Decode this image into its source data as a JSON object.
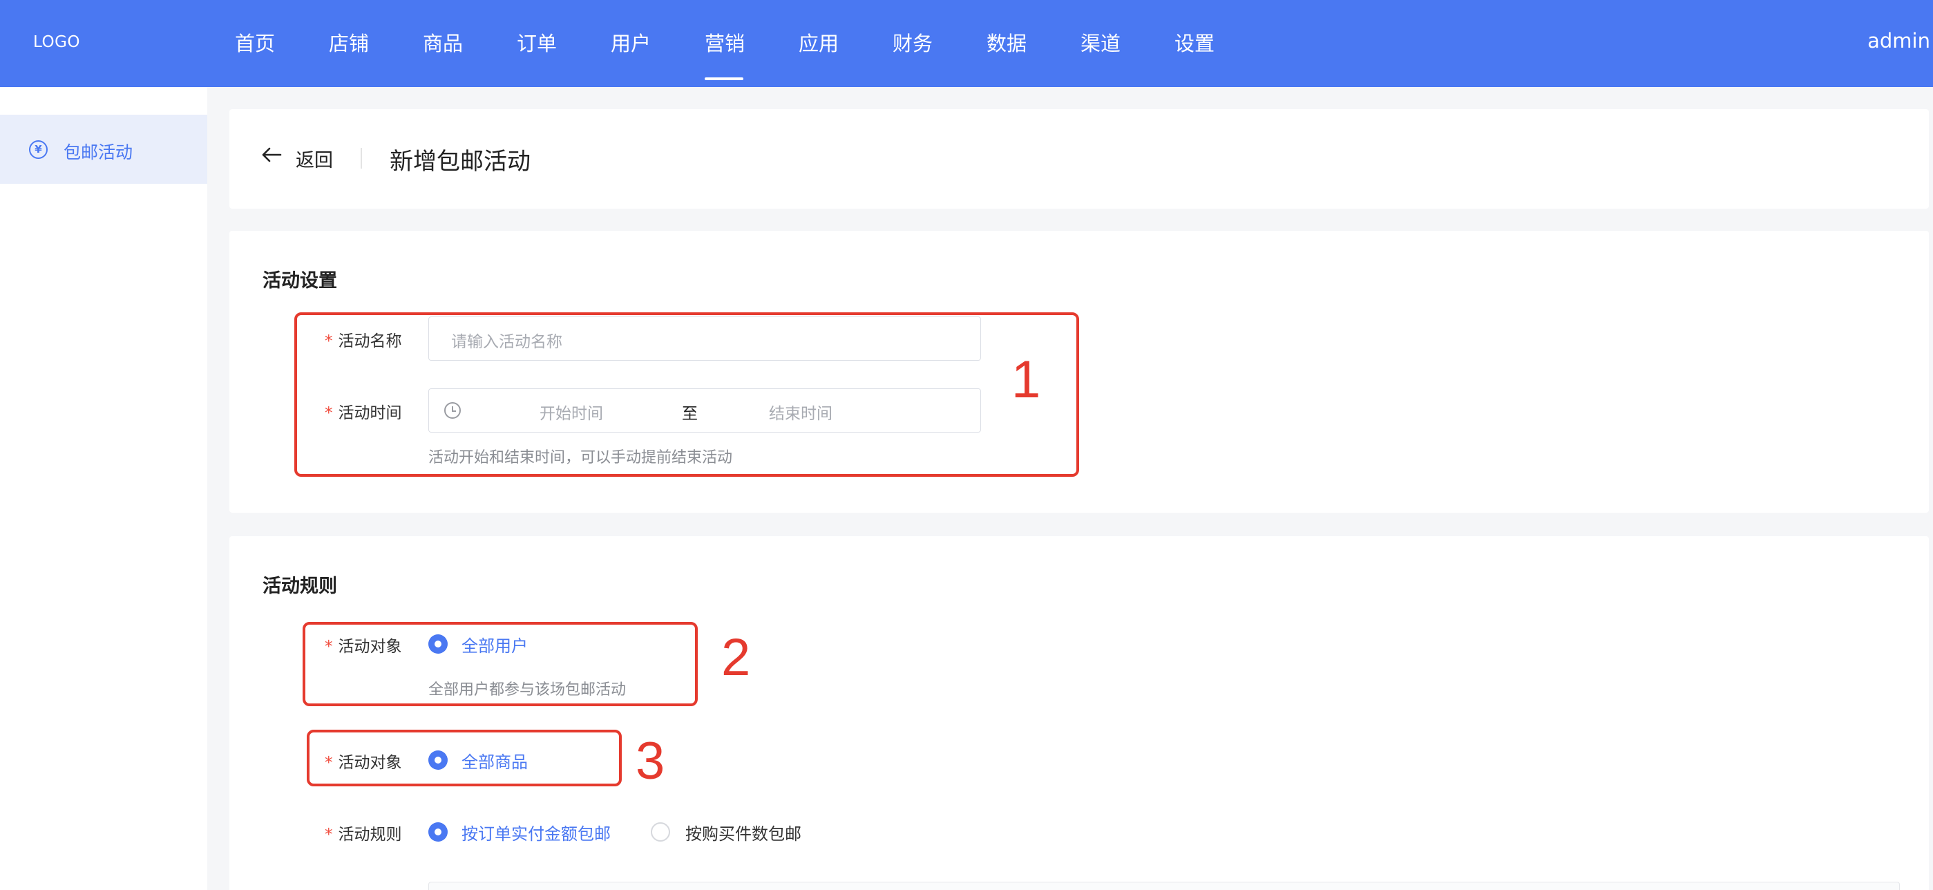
{
  "header": {
    "logo": "LOGO",
    "nav": [
      "首页",
      "店铺",
      "商品",
      "订单",
      "用户",
      "营销",
      "应用",
      "财务",
      "数据",
      "渠道",
      "设置"
    ],
    "active_nav": "营销",
    "user": "admin",
    "colors": {
      "brand": "#4a78f2",
      "annotation": "#e53a2e",
      "required": "#f04a3b"
    }
  },
  "sidebar": {
    "items": [
      {
        "label": "包邮活动",
        "icon": "yen-circle-icon",
        "active": true
      }
    ]
  },
  "page_header": {
    "back_label": "返回",
    "title": "新增包邮活动"
  },
  "settings": {
    "title": "活动设置",
    "name_label": "活动名称",
    "name_placeholder": "请输入活动名称",
    "time_label": "活动时间",
    "start_placeholder": "开始时间",
    "range_sep": "至",
    "end_placeholder": "结束时间",
    "time_help": "活动开始和结束时间，可以手动提前结束活动"
  },
  "rules": {
    "title": "活动规则",
    "target_user_label": "活动对象",
    "target_user_option": "全部用户",
    "target_user_help": "全部用户都参与该场包邮活动",
    "target_goods_label": "活动对象",
    "target_goods_option": "全部商品",
    "rule_label": "活动规则",
    "rule_options": [
      "按订单实付金额包邮",
      "按购买件数包邮"
    ],
    "rule_selected": "按订单实付金额包邮"
  },
  "annotations": [
    "1",
    "2",
    "3"
  ]
}
